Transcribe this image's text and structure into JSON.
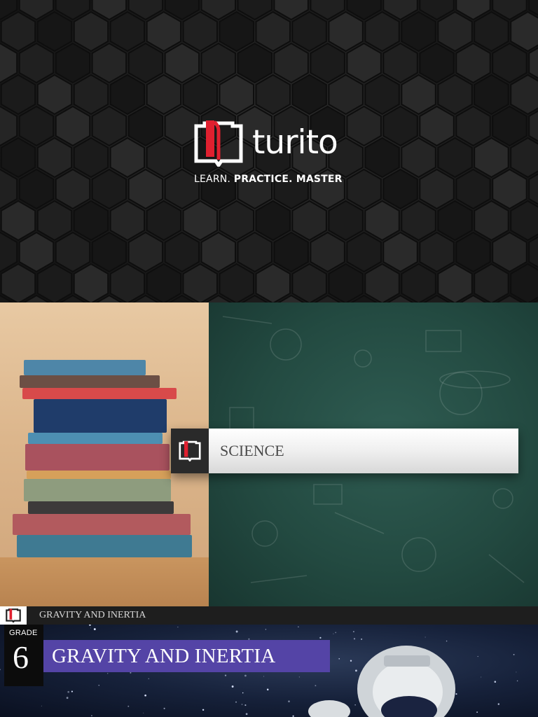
{
  "brand": {
    "name": "turito",
    "tagline_parts": [
      "LEARN. ",
      "PRACTICE. ",
      "MASTER"
    ],
    "accent_color": "#e0202f",
    "logo_icon": "open-book-icon"
  },
  "subject": {
    "label": "SCIENCE",
    "icon": "open-book-icon"
  },
  "chapter_strip": {
    "text": "GRAVITY AND INERTIA",
    "icon": "open-book-icon"
  },
  "cover": {
    "grade_label": "GRADE",
    "grade_number": "6",
    "title": "GRAVITY AND INERTIA",
    "title_band_color": "#5444a6"
  }
}
